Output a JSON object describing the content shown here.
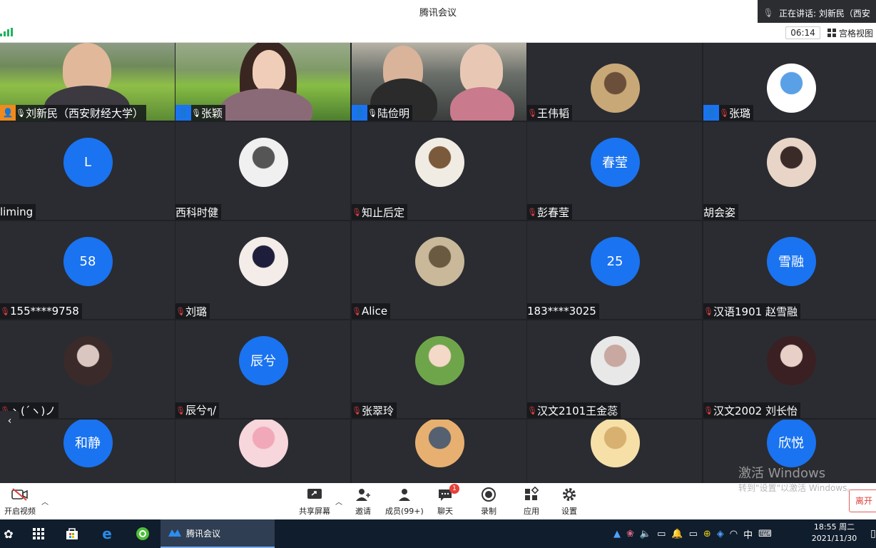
{
  "window": {
    "title": "腾讯会议"
  },
  "speaking": {
    "text": "正在讲话: 刘新民（西安"
  },
  "header": {
    "timer": "06:14",
    "view_label": "宫格视图",
    "left_status": "中"
  },
  "participants": [
    {
      "name": "刘新民（西安财经大学）",
      "type": "video",
      "badge": "orange"
    },
    {
      "name": "张颖",
      "type": "video",
      "badge": "blue"
    },
    {
      "name": "陆俭明",
      "type": "video",
      "badge": "blue"
    },
    {
      "name": "王伟韬",
      "type": "avatar-img"
    },
    {
      "name": "张璐",
      "type": "avatar-img",
      "badge": "blue"
    },
    {
      "name": "liming",
      "type": "avatar",
      "initial": "L"
    },
    {
      "name": "西科时健",
      "type": "avatar-img"
    },
    {
      "name": "知止后定",
      "type": "avatar-img"
    },
    {
      "name": "彭春莹",
      "type": "avatar",
      "initial": "春莹"
    },
    {
      "name": "胡会姿",
      "type": "avatar-img"
    },
    {
      "name": "155****9758",
      "type": "avatar",
      "initial": "58"
    },
    {
      "name": "刘璐",
      "type": "avatar-img"
    },
    {
      "name": "Alice",
      "type": "avatar-img"
    },
    {
      "name": "183****3025",
      "type": "avatar",
      "initial": "25"
    },
    {
      "name": "汉语1901 赵雪融",
      "type": "avatar",
      "initial": "雪融"
    },
    {
      "name": "ヽ(´ヽ)ノ",
      "type": "avatar-img"
    },
    {
      "name": "辰兮ๆ/",
      "type": "avatar",
      "initial": "辰兮"
    },
    {
      "name": "张翠玲",
      "type": "avatar-img"
    },
    {
      "name": "汉文2101王金蕊",
      "type": "avatar-img"
    },
    {
      "name": "汉文2002 刘长怡",
      "type": "avatar-img"
    },
    {
      "name": "",
      "type": "avatar",
      "initial": "和静"
    },
    {
      "name": "",
      "type": "avatar-img"
    },
    {
      "name": "",
      "type": "avatar-img"
    },
    {
      "name": "",
      "type": "avatar-img"
    },
    {
      "name": "",
      "type": "avatar",
      "initial": "欣悦"
    }
  ],
  "toolbar": {
    "video_label": "开启视频",
    "share_label": "共享屏幕",
    "invite_label": "邀请",
    "members_label": "成员(99+)",
    "chat_label": "聊天",
    "chat_badge": "1",
    "record_label": "录制",
    "apps_label": "应用",
    "settings_label": "设置",
    "leave_label": "离开"
  },
  "watermark": {
    "line1": "激活 Windows",
    "line2": "转到\"设置\"以激活 Windows。"
  },
  "taskbar": {
    "app_label": "腾讯会议",
    "time": "18:55 周二",
    "date": "2021/11/30",
    "ime": "中"
  }
}
